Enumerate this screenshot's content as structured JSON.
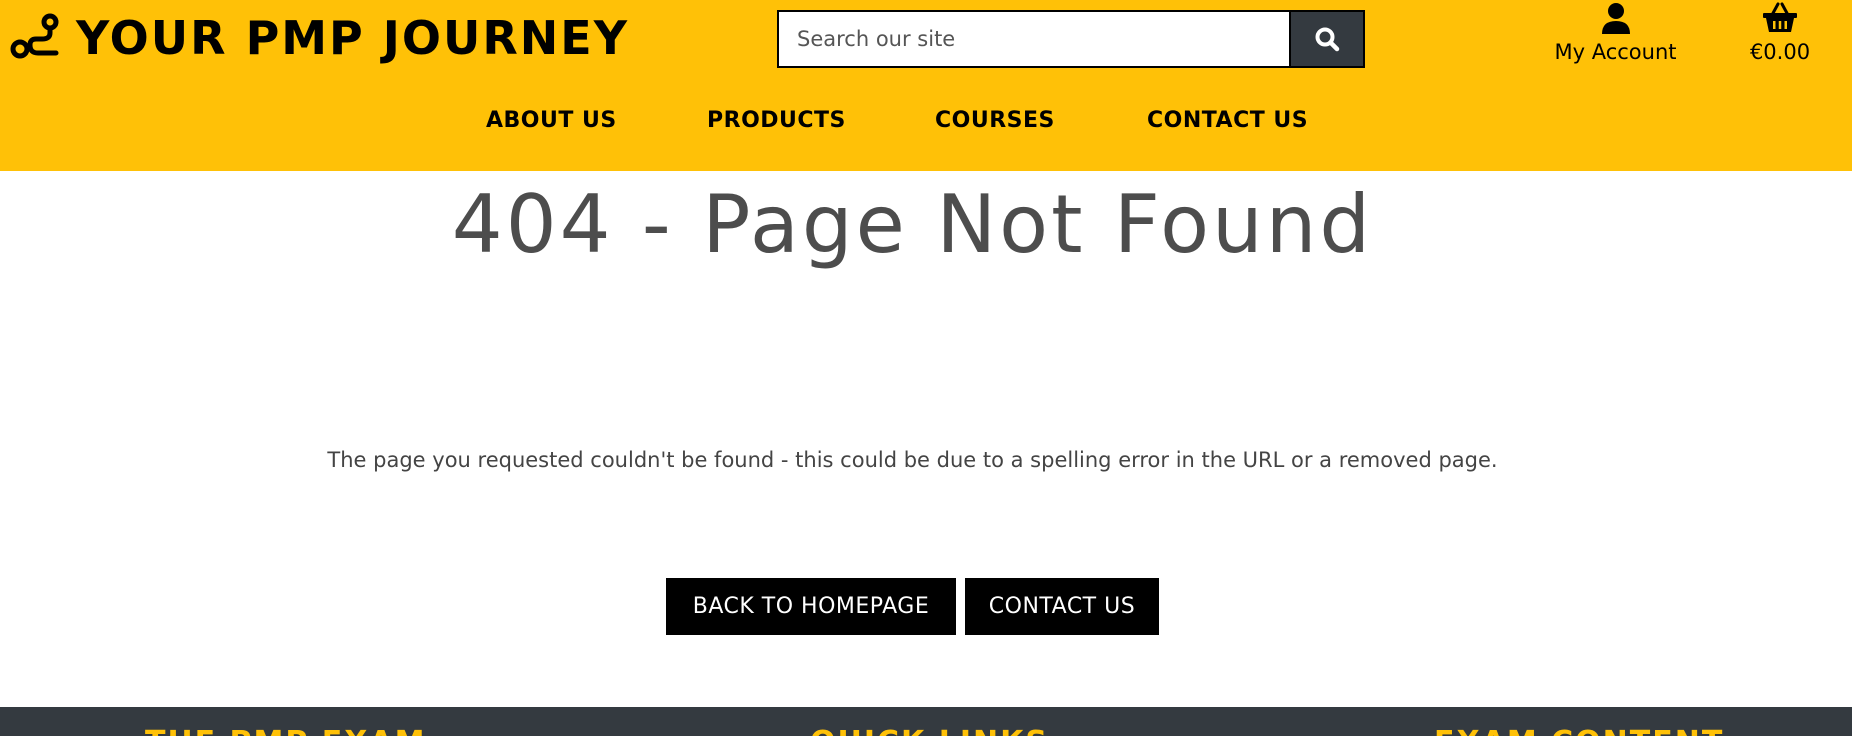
{
  "brand": {
    "name": "YOUR PMP JOURNEY",
    "icon": "route-icon"
  },
  "search": {
    "placeholder": "Search our site",
    "value": "",
    "icon": "search-icon"
  },
  "account": {
    "label": "My Account",
    "icon": "user-icon"
  },
  "cart": {
    "total": "€0.00",
    "icon": "shopping-basket-icon"
  },
  "nav": {
    "items": [
      {
        "label": "ABOUT US"
      },
      {
        "label": "PRODUCTS"
      },
      {
        "label": "COURSES"
      },
      {
        "label": "CONTACT US"
      }
    ]
  },
  "main": {
    "title": "404 - Page Not Found",
    "message": "The page you requested couldn't be found - this could be due to a spelling error in the URL or a removed page.",
    "buttons": {
      "home": "BACK TO HOMEPAGE",
      "contact": "CONTACT US"
    }
  },
  "footer": {
    "headings": [
      "THE PMP EXAM",
      "QUICK LINKS",
      "EXAM CONTENT"
    ]
  },
  "colors": {
    "header_bg": "#FFC107",
    "footer_bg": "#343A40",
    "footer_heading": "#FFC107",
    "search_button_bg": "#343A40",
    "button_bg": "#000000",
    "title_text": "#4d4d4d"
  }
}
